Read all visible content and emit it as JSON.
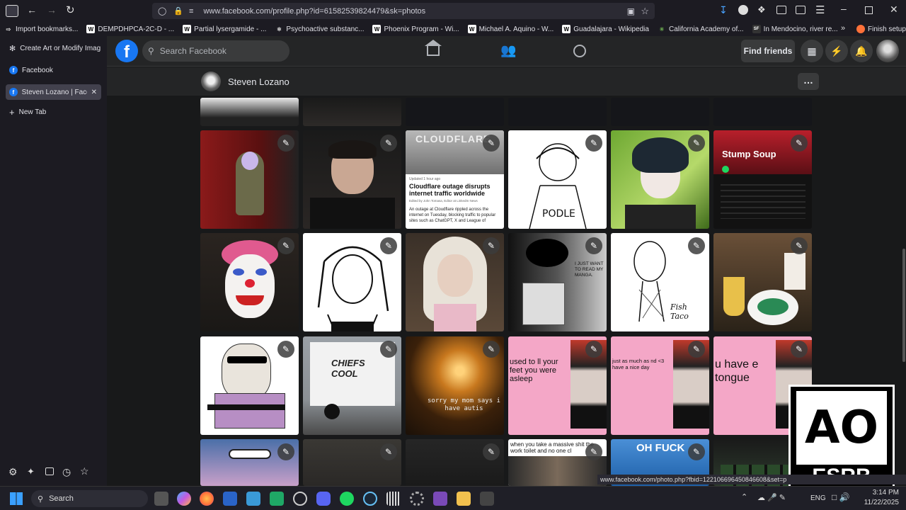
{
  "browser": {
    "url": "www.facebook.com/profile.php?id=61582539824479&sk=photos",
    "bookmarks": [
      {
        "label": "Import bookmarks...",
        "color": "#e0e0e6"
      },
      {
        "label": "DEMPDHPCA-2C-D - ...",
        "color": "#ffffff"
      },
      {
        "label": "Partial lysergamide - ...",
        "color": "#ffffff"
      },
      {
        "label": "Psychoactive substanc...",
        "color": "#e0e0e6"
      },
      {
        "label": "Phoenix Program - Wi...",
        "color": "#ffffff"
      },
      {
        "label": "Michael A. Aquino - W...",
        "color": "#ffffff"
      },
      {
        "label": "Guadalajara - Wikipedia",
        "color": "#ffffff"
      },
      {
        "label": "California Academy of...",
        "color": "#6aa84f"
      },
      {
        "label": "In Mendocino, river re...",
        "color": "#e0e0e6"
      }
    ],
    "finish_setup": "Finish setup",
    "side_tabs": {
      "tab1": "Create Art or Modify Imag",
      "tab2": "Facebook",
      "tab3": "Steven Lozano | Faceb",
      "new_tab": "New Tab"
    },
    "status_link": "www.facebook.com/photo.php?fbid=122106696450846608&set=p"
  },
  "facebook": {
    "search_placeholder": "Search Facebook",
    "find_friends": "Find friends",
    "profile_name": "Steven Lozano",
    "more": "…"
  },
  "tiles": {
    "row0": [
      "",
      "",
      "",
      "",
      "",
      ""
    ],
    "cloudflare_banner": "CLOUDFLARE",
    "cloudflare_headline": "Cloudflare outage disrupts internet traffic worldwide",
    "cloudflare_meta": "Updated 1 hour ago",
    "cloudflare_byline": "Edited by John Tomasa, Editor at LinkedIn News",
    "cloudflare_body": "An outage at Cloudflare rippled across the internet on Tuesday, blocking traffic to popular sites such as ChatGPT, X and League of",
    "stump_soup": "Stump Soup",
    "manga_text": "I JUST WANT TO READ MY MANGA.",
    "fish_taco": "Fish Taco",
    "chiefs_graffiti": "CHIEFS COOL",
    "sorry_mom": "sorry my mom says i have autis",
    "pink1": "used to ll your feet you were asleep",
    "pink2": "just as much as nd <3 have a nice day",
    "pink3": "u have e tongue",
    "meme_toilet": "when you take a massive shit the work toilet and no one cl",
    "oh_fuck": "OH FUCK"
  },
  "esrb": {
    "rating": "AO",
    "label": "ESRB"
  },
  "taskbar": {
    "search": "Search",
    "lang": "ENG",
    "time": "3:14 PM",
    "date": "11/22/2025"
  }
}
